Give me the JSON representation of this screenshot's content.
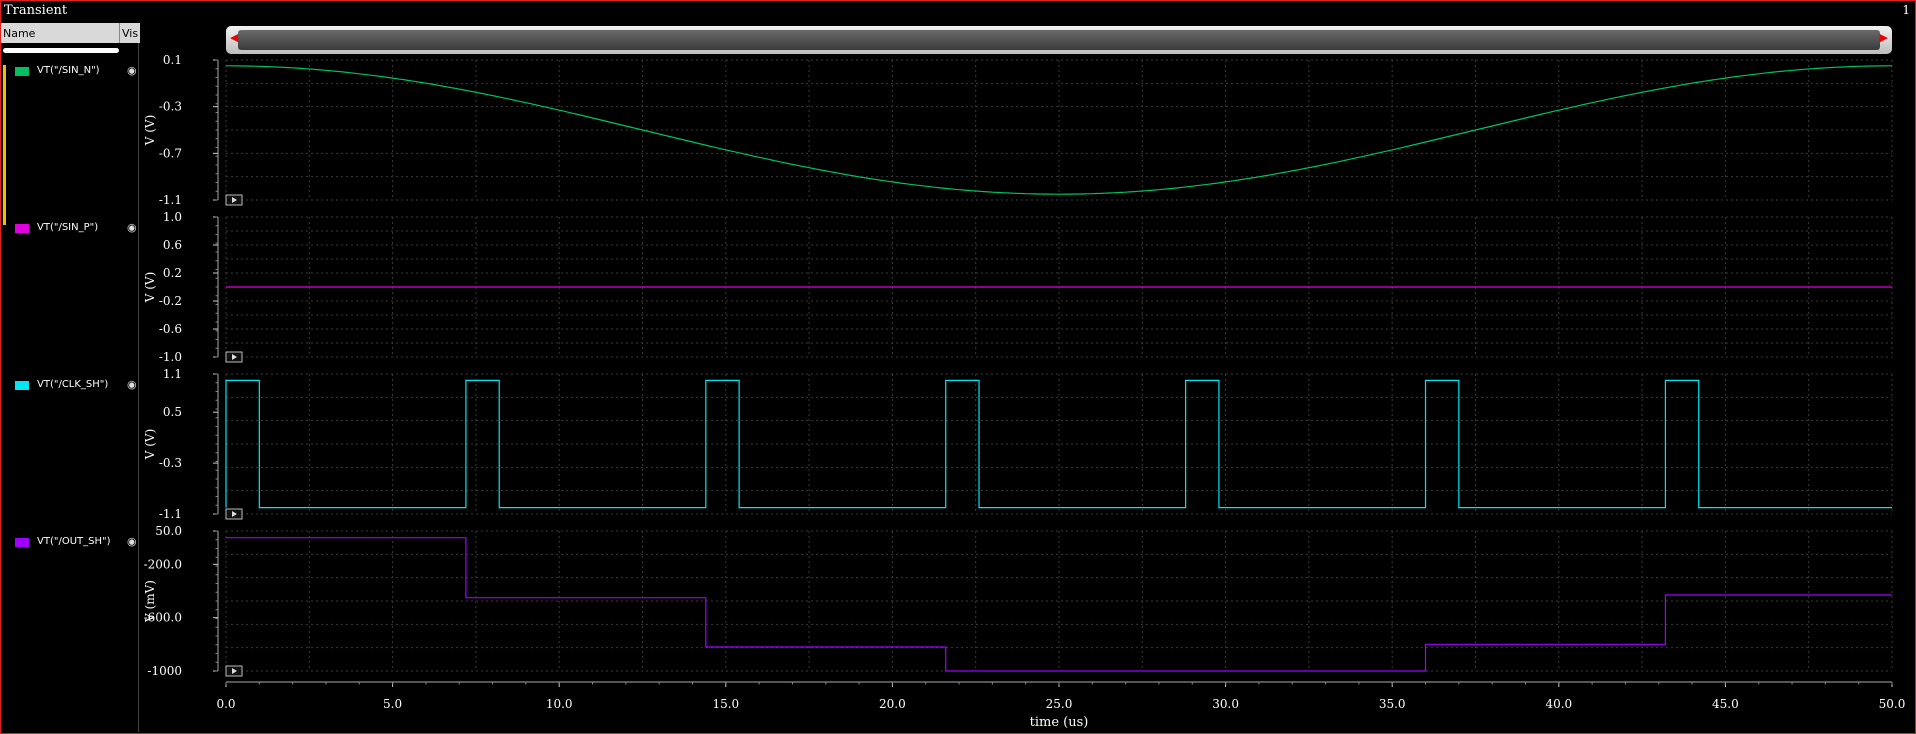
{
  "window": {
    "title": "Transient",
    "number": "1"
  },
  "panel": {
    "col_name": "Name",
    "col_vis": "Vis"
  },
  "icons": {
    "visibility": "eye-icon",
    "expand": "play-icon",
    "scroll_left": "left-arrow-icon",
    "scroll_right": "right-arrow-icon"
  },
  "chart_data": {
    "type": "line",
    "xlabel": "time (us)",
    "xlim": [
      0,
      50
    ],
    "x_ticks": [
      "0.0",
      "5.0",
      "10.0",
      "15.0",
      "20.0",
      "25.0",
      "30.0",
      "35.0",
      "40.0",
      "45.0",
      "50.0"
    ],
    "grid": true,
    "charts": [
      {
        "name": "VT(\"/SIN_N\")",
        "color": "#00c060",
        "ylabel": "V (V)",
        "ylim": [
          -1.1,
          0.1
        ],
        "y_ticks": [
          "0.1",
          "-0.3",
          "-0.7",
          "-1.1"
        ],
        "kind": "sine",
        "center": -0.5,
        "amplitude": 0.55,
        "period": 50,
        "phase_deg": 90
      },
      {
        "name": "VT(\"/SIN_P\")",
        "color": "#e000e0",
        "ylabel": "V (V)",
        "ylim": [
          -1.0,
          1.0
        ],
        "y_ticks": [
          "1.0",
          "0.6",
          "0.2",
          "-0.2",
          "-0.6",
          "-1.0"
        ],
        "kind": "points",
        "x": [
          0,
          50
        ],
        "y": [
          0.0,
          0.0
        ]
      },
      {
        "name": "VT(\"/CLK_SH\")",
        "color": "#00e5f0",
        "ylabel": "V (V)",
        "ylim": [
          -1.1,
          1.1
        ],
        "y_ticks": [
          "1.1",
          "0.5",
          "-0.3",
          "-1.1"
        ],
        "kind": "pulse",
        "high": 1.0,
        "low": -1.0,
        "high_intervals": [
          [
            0,
            1.0
          ],
          [
            7.2,
            8.2
          ],
          [
            14.4,
            15.4
          ],
          [
            21.6,
            22.6
          ],
          [
            28.8,
            29.8
          ],
          [
            36.0,
            37.0
          ],
          [
            43.2,
            44.2
          ]
        ]
      },
      {
        "name": "VT(\"/OUT_SH\")",
        "color": "#a000ff",
        "ylabel": "V (mV)",
        "ylim": [
          -1000,
          50
        ],
        "y_ticks": [
          "50.0",
          "-200.0",
          "-600.0",
          "-1000"
        ],
        "kind": "steps",
        "x": [
          0,
          7.2,
          14.4,
          21.6,
          36.0,
          43.2,
          50
        ],
        "y": [
          0,
          -450,
          -820,
          -1000,
          -800,
          -430,
          -430
        ]
      }
    ]
  }
}
